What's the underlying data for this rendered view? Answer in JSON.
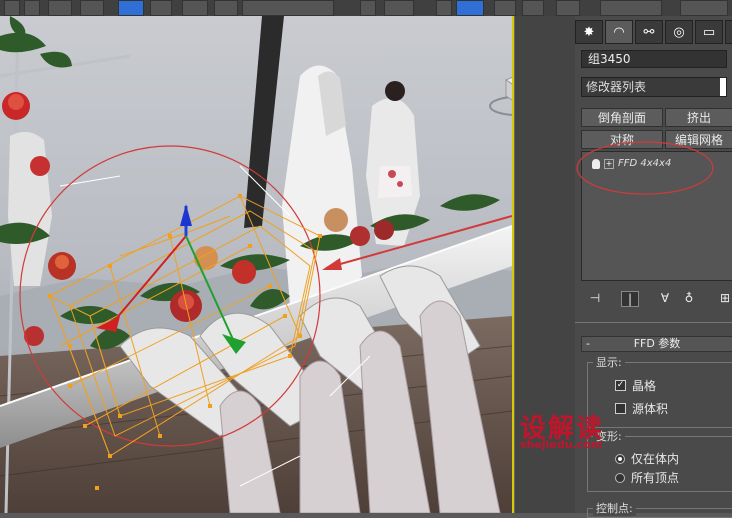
{
  "panel": {
    "object_name": "组3450",
    "modifier_list": "修改器列表",
    "buttons": {
      "bevel_profile": "倒角剖面",
      "extrude": "挤出",
      "symmetry": "对称",
      "edit_mesh": "编辑网格"
    },
    "stack_item": "FFD 4x4x4",
    "rollout_title": "FFD 参数",
    "rollout_minus": "-",
    "display_group": "显示:",
    "lattice": "晶格",
    "source_volume": "源体积",
    "deform_group": "变形:",
    "only_in_volume": "仅在体内",
    "all_vertices": "所有顶点",
    "control_points_group": "控制点:"
  },
  "watermark": {
    "main": "设解读",
    "url": "shejiedu.com"
  },
  "colors": {
    "accent_yellow": "#d9c900",
    "annotation_red": "#d23a3a",
    "lattice_orange": "#f0a020",
    "active_blue": "#2f6fd6"
  }
}
